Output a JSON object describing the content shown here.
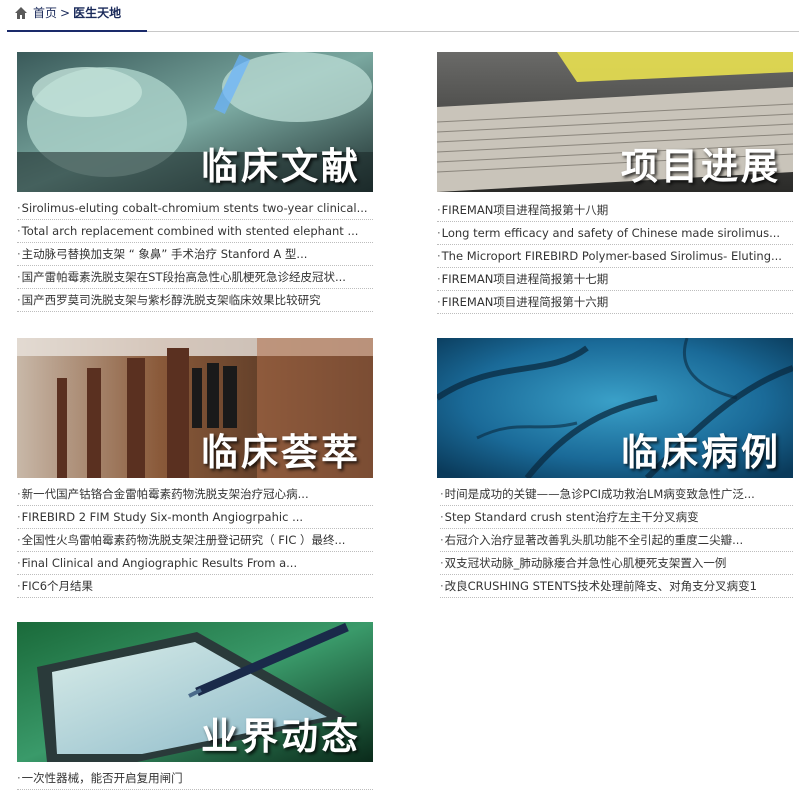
{
  "breadcrumb": {
    "home": "首页",
    "separator": ">",
    "current": "医生天地"
  },
  "sections": [
    {
      "title": "临床文献",
      "items": [
        "Sirolimus-eluting cobalt-chromium stents two-year clinical...",
        "Total arch replacement combined with stented elephant ...",
        "主动脉弓替换加支架 “ 象鼻” 手术治疗  Stanford A 型...",
        "国产雷帕霉素洗脱支架在ST段抬高急性心肌梗死急诊经皮冠状...",
        "国产西罗莫司洗脱支架与紫杉醇洗脱支架临床效果比较研究"
      ]
    },
    {
      "title": "项目进展",
      "items": [
        "FIREMAN项目进程简报第十八期",
        "Long term efficacy and safety of Chinese made sirolimus...",
        "The Microport FIREBIRD Polymer-based Sirolimus- Eluting...",
        "FIREMAN项目进程简报第十七期",
        "FIREMAN项目进程简报第十六期"
      ]
    },
    {
      "title": "临床荟萃",
      "items": [
        "新一代国产钴铬合金雷帕霉素药物洗脱支架治疗冠心病...",
        "FIREBIRD 2 FIM Study Six-month Angiogrpahic ...",
        "全国性火鸟雷帕霉素药物洗脱支架注册登记研究（ FIC ）最终...",
        "Final Clinical and Angiographic Results From a...",
        "FIC6个月结果"
      ]
    },
    {
      "title": "临床病例",
      "items": [
        "时间是成功的关键——急诊PCI成功救治LM病变致急性广泛...",
        "Step Standard crush stent治疗左主干分叉病变",
        "右冠介入治疗显著改善乳头肌功能不全引起的重度二尖瓣...",
        "双支冠状动脉_肺动脉瘘合并急性心肌梗死支架置入一例",
        "改良CRUSHING STENTS技术处理前降支、对角支分叉病变1"
      ]
    },
    {
      "title": "业界动态",
      "items": [
        "一次性器械，能否开启复用闸门"
      ]
    }
  ]
}
